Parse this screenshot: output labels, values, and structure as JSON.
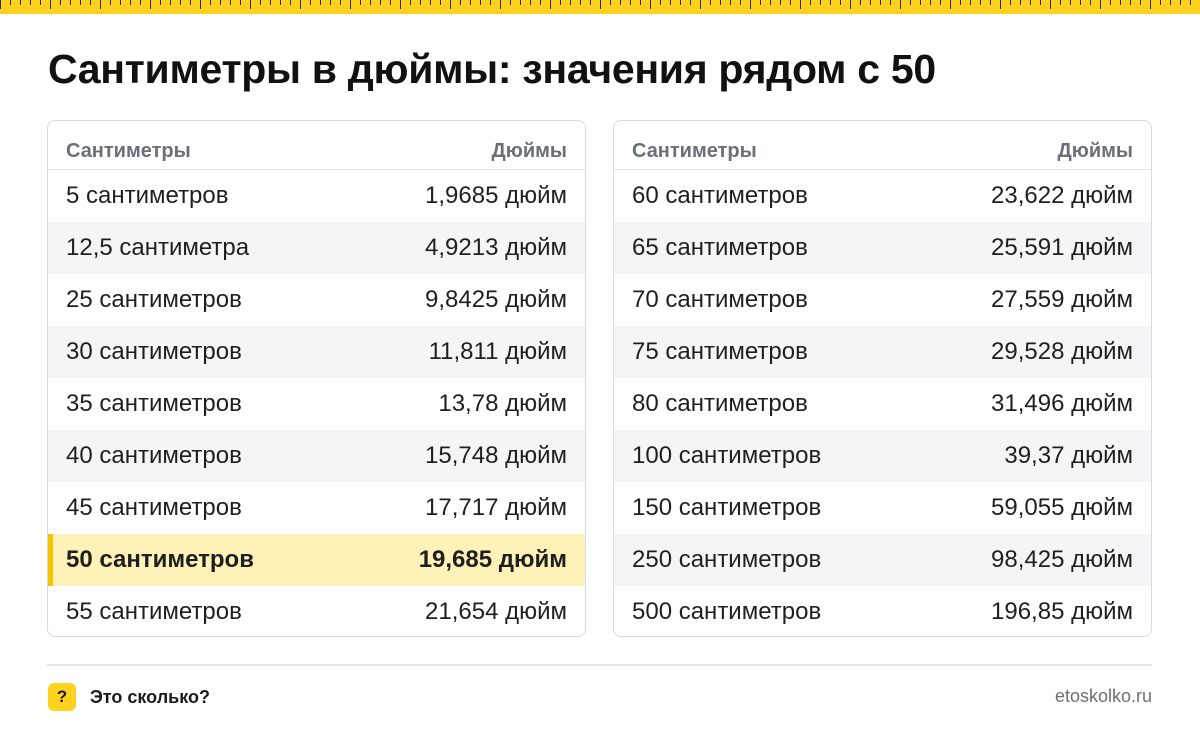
{
  "title": "Сантиметры в дюймы: значения рядом с 50",
  "colors": {
    "accent": "#ffd21f",
    "highlight_bg": "#fff2b8",
    "highlight_bar": "#f5c400"
  },
  "tables": [
    {
      "headers": {
        "cm": "Сантиметры",
        "in": "Дюймы"
      },
      "rows": [
        {
          "cm": "5 сантиметров",
          "in": "1,9685 дюйм"
        },
        {
          "cm": "12,5 сантиметра",
          "in": "4,9213 дюйм"
        },
        {
          "cm": "25 сантиметров",
          "in": "9,8425 дюйм"
        },
        {
          "cm": "30 сантиметров",
          "in": "11,811 дюйм"
        },
        {
          "cm": "35 сантиметров",
          "in": "13,78 дюйм"
        },
        {
          "cm": "40 сантиметров",
          "in": "15,748 дюйм"
        },
        {
          "cm": "45 сантиметров",
          "in": "17,717 дюйм"
        },
        {
          "cm": "50 сантиметров",
          "in": "19,685 дюйм",
          "highlight": true
        },
        {
          "cm": "55 сантиметров",
          "in": "21,654 дюйм"
        }
      ]
    },
    {
      "headers": {
        "cm": "Сантиметры",
        "in": "Дюймы"
      },
      "rows": [
        {
          "cm": "60 сантиметров",
          "in": "23,622 дюйм"
        },
        {
          "cm": "65 сантиметров",
          "in": "25,591 дюйм"
        },
        {
          "cm": "70 сантиметров",
          "in": "27,559 дюйм"
        },
        {
          "cm": "75 сантиметров",
          "in": "29,528 дюйм"
        },
        {
          "cm": "80 сантиметров",
          "in": "31,496 дюйм"
        },
        {
          "cm": "100 сантиметров",
          "in": "39,37 дюйм"
        },
        {
          "cm": "150 сантиметров",
          "in": "59,055 дюйм"
        },
        {
          "cm": "250 сантиметров",
          "in": "98,425 дюйм"
        },
        {
          "cm": "500 сантиметров",
          "in": "196,85 дюйм"
        }
      ]
    }
  ],
  "footer": {
    "icon": "question-icon",
    "icon_glyph": "?",
    "brand": "Это сколько?",
    "site": "etoskolko.ru"
  }
}
